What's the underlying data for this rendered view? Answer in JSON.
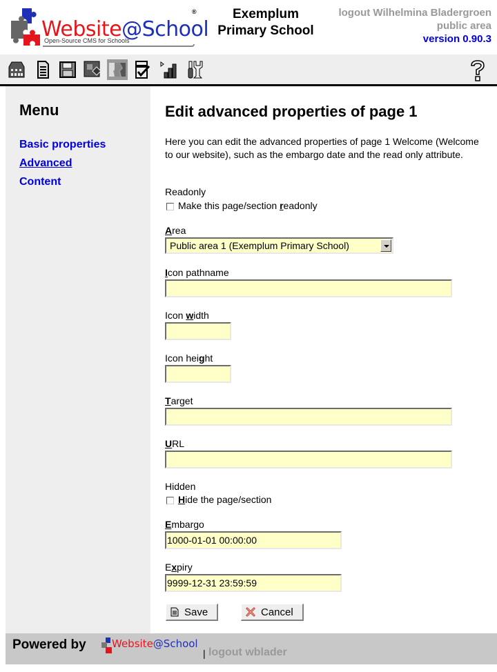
{
  "header": {
    "logo_text_1": "Website",
    "logo_text_2": "@School",
    "logo_tagline": "Open-Source CMS for Schools",
    "logo_registered": "®",
    "site_name_line1": "Exemplum",
    "site_name_line2": "Primary School",
    "logout_link": "logout Wilhelmina Bladergroen",
    "area_label": "public area",
    "version": "version 0.90.3"
  },
  "toolbar": {
    "icons": [
      "start-icon",
      "page-manager-icon",
      "save-backup-icon",
      "modules-icon",
      "account-manager-icon",
      "configuration-icon",
      "statistics-icon",
      "tools-icon"
    ],
    "help_icon": "help-icon"
  },
  "sidebar": {
    "title": "Menu",
    "items": [
      {
        "label": "Basic properties",
        "active": false
      },
      {
        "label": "Advanced",
        "active": true
      },
      {
        "label": "Content",
        "active": false
      }
    ]
  },
  "main": {
    "title": "Edit advanced properties of page 1",
    "intro": "Here you can edit the advanced properties of page 1 Welcome (Welcome to our website), such as the embargo date and the read only attribute.",
    "readonly": {
      "label": "Readonly",
      "checkbox_pre": "Make this page/section ",
      "checkbox_key": "r",
      "checkbox_post": "eadonly",
      "checked": false
    },
    "area": {
      "label_key": "A",
      "label_rest": "rea",
      "selected": "Public area 1 (Exemplum Primary School)"
    },
    "icon_pathname": {
      "label_key": "I",
      "label_rest": "con pathname",
      "value": ""
    },
    "icon_width": {
      "label_pre": "Icon ",
      "label_key": "w",
      "label_rest": "idth",
      "value": ""
    },
    "icon_height": {
      "label_pre": "Icon hei",
      "label_key": "g",
      "label_rest": "ht",
      "value": ""
    },
    "target": {
      "label_key": "T",
      "label_rest": "arget",
      "value": ""
    },
    "url": {
      "label_key": "U",
      "label_rest": "RL",
      "value": ""
    },
    "hidden": {
      "label": "Hidden",
      "checkbox_key": "H",
      "checkbox_post": "ide the page/section",
      "checked": false
    },
    "embargo": {
      "label_key": "E",
      "label_rest": "mbargo",
      "value": "1000-01-01 00:00:00"
    },
    "expiry": {
      "label_pre": "E",
      "label_key": "x",
      "label_rest": "piry",
      "value": "9999-12-31 23:59:59"
    },
    "save_label": "Save",
    "cancel_label": "Cancel"
  },
  "footer": {
    "powered_by": "Powered by",
    "logo_text_1": "Website",
    "logo_text_2": "@School",
    "separator": "|",
    "logout": "logout wblader"
  },
  "colors": {
    "link": "#0000dd",
    "muted": "#999999",
    "input_bg": "#ffffc8",
    "panel_bg": "#eeeeee",
    "footer_bg": "#c8c8c8",
    "logo_red": "#e4161c",
    "logo_blue": "#1e2fb8"
  }
}
